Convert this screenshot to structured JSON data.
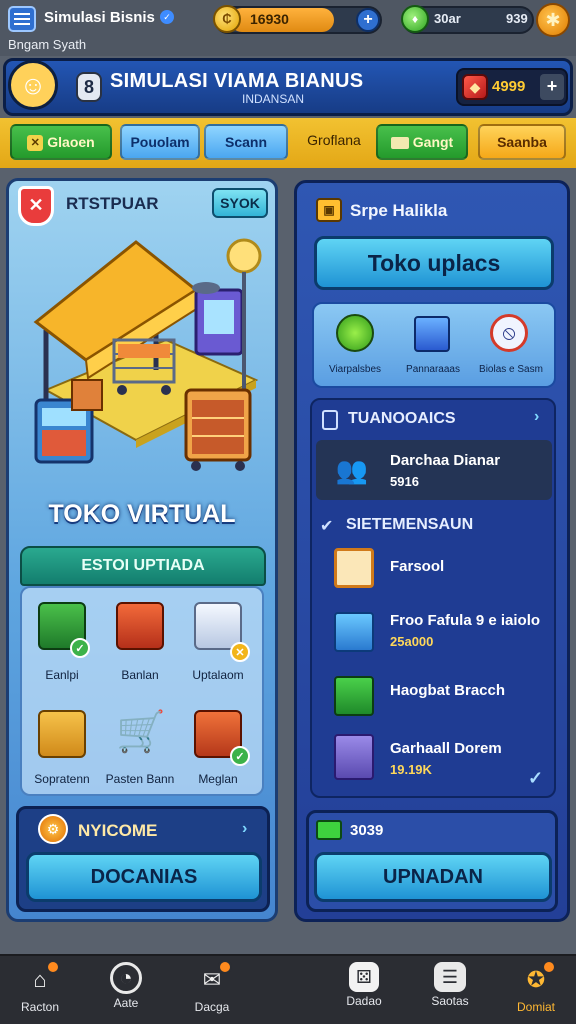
{
  "topbar": {
    "app_title": "Simulasi Bisnis",
    "subtitle": "Bngam Syath",
    "coins": "16930",
    "gems_label": "30ar",
    "gems_value": "939"
  },
  "banner": {
    "title": "SIMULASI VIAMA BIANUS",
    "subtitle": "INDANSAN",
    "gem_value": "4999"
  },
  "tabs": [
    {
      "label": "Glaoen",
      "style": "green"
    },
    {
      "label": "Pouolam",
      "style": "blue"
    },
    {
      "label": "Scann",
      "style": "blue"
    },
    {
      "label": "Groflana",
      "style": "ghost"
    },
    {
      "label": "Gangt",
      "style": "green"
    },
    {
      "label": "Saanba",
      "style": "gold"
    }
  ],
  "shop": {
    "name": "RTSTPUAR",
    "tag": "SYOK",
    "title": "TOKO VIRTUAL",
    "upgrade_header": "ESTOI UPTIADA",
    "items": [
      "Eanlpi",
      "Banlan",
      "Uptalaom",
      "Sopratenn",
      "Pasten Bann",
      "Meglan"
    ]
  },
  "income": {
    "title": "NYICOME",
    "button": "DOCANIAS"
  },
  "right": {
    "title": "Srpe Halikla",
    "main_button": "Toko uplacs",
    "mini_items": [
      "Viarpalsbes",
      "Pannaraaas",
      "Biolas e Sasm"
    ],
    "section1_title": "TUANOOAICS",
    "section1_row": {
      "title": "Darchaa Dianar",
      "value": "5916"
    },
    "section2_title": "SIETEMENSAUN",
    "rows": [
      {
        "title": "Farsool",
        "value": ""
      },
      {
        "title": "Froo Fafula 9 e iaiolo",
        "value": "25a000"
      },
      {
        "title": "Haogbat Bracch",
        "value": ""
      },
      {
        "title": "Garhaall Dorem",
        "value": "19.19K"
      }
    ],
    "bottom_value": "3039",
    "bottom_button": "UPNADAN"
  },
  "navbar": {
    "items": [
      "Racton",
      "Aate",
      "Dacga",
      "Dadao",
      "Saotas",
      "Domiat"
    ]
  },
  "colors": {
    "accent_gold": "#f2c231",
    "panel_blue": "#233f97",
    "button_cyan": "#33b4d6"
  }
}
